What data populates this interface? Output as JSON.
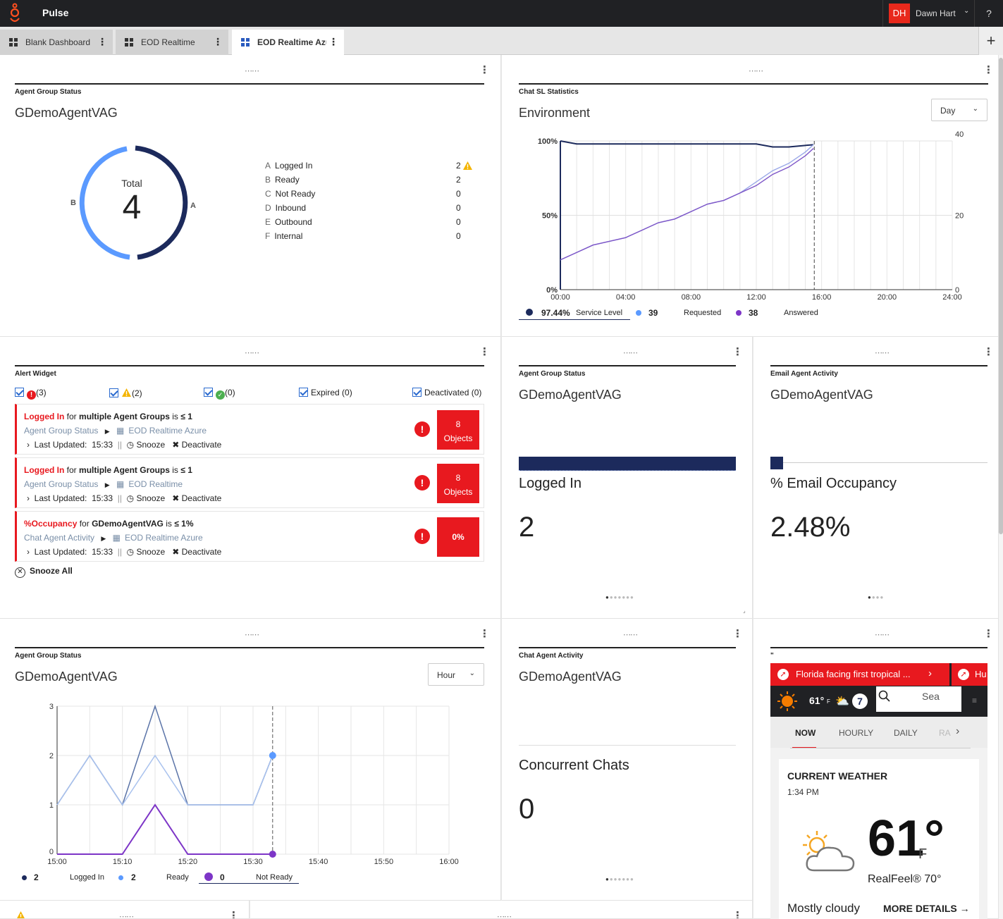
{
  "app": {
    "title": "Pulse",
    "user_initials": "DH",
    "user_name": "Dawn Hart",
    "help": "?"
  },
  "tabs": [
    {
      "label": "Blank Dashboard"
    },
    {
      "label": "EOD Realtime"
    },
    {
      "label": "EOD Realtime Azure"
    }
  ],
  "agent_status": {
    "type": "Agent Group Status",
    "title": "GDemoAgentVAG",
    "total_label": "Total",
    "total": "4",
    "seg_a": "A",
    "seg_b": "B",
    "legend": [
      {
        "letter": "A",
        "label": "Logged In",
        "value": "2"
      },
      {
        "letter": "B",
        "label": "Ready",
        "value": "2"
      },
      {
        "letter": "C",
        "label": "Not Ready",
        "value": "0"
      },
      {
        "letter": "D",
        "label": "Inbound",
        "value": "0"
      },
      {
        "letter": "E",
        "label": "Outbound",
        "value": "0"
      },
      {
        "letter": "F",
        "label": "Internal",
        "value": "0"
      }
    ]
  },
  "chat_sl": {
    "type": "Chat SL Statistics",
    "title": "Environment",
    "period": "Day",
    "legend": {
      "sl_value": "97.44%",
      "sl_label": "Service Level",
      "req_value": "39",
      "req_label": "Requested",
      "ans_value": "38",
      "ans_label": "Answered"
    }
  },
  "alerts": {
    "type": "Alert Widget",
    "filters": {
      "red": "(3)",
      "warn": "(2)",
      "ok": "(0)",
      "expired": "Expired (0)",
      "deactivated": "Deactivated (0)"
    },
    "items": [
      {
        "metric": "Logged In",
        "for": "for",
        "object": "multiple Agent Groups",
        "is": "is",
        "cond": "≤ 1",
        "src": "Agent Group Status",
        "dash": "EOD Realtime Azure",
        "updated_label": "Last Updated:",
        "time": "15:33",
        "snooze": "Snooze",
        "deactivate": "Deactivate",
        "count_n": "8",
        "count_l": "Objects"
      },
      {
        "metric": "Logged In",
        "for": "for",
        "object": "multiple Agent Groups",
        "is": "is",
        "cond": "≤ 1",
        "src": "Agent Group Status",
        "dash": "EOD Realtime",
        "updated_label": "Last Updated:",
        "time": "15:33",
        "snooze": "Snooze",
        "deactivate": "Deactivate",
        "count_n": "8",
        "count_l": "Objects"
      },
      {
        "metric": "%Occupancy",
        "for": "for",
        "object": "GDemoAgentVAG",
        "is": "is",
        "cond": "≤ 1%",
        "src": "Chat Agent Activity",
        "dash": "EOD Realtime Azure",
        "updated_label": "Last Updated:",
        "time": "15:33",
        "snooze": "Snooze",
        "deactivate": "Deactivate",
        "count_n": "0%",
        "count_l": ""
      }
    ],
    "snooze_all": "Snooze All"
  },
  "kpi_logged": {
    "type": "Agent Group Status",
    "title": "GDemoAgentVAG",
    "label": "Logged In",
    "value": "2"
  },
  "kpi_email": {
    "type": "Email Agent Activity",
    "title": "GDemoAgentVAG",
    "label": "% Email Occupancy",
    "value": "2.48%",
    "fill": 0.0248
  },
  "agent_hour": {
    "type": "Agent Group Status",
    "title": "GDemoAgentVAG",
    "period": "Hour",
    "legend": {
      "li_value": "2",
      "li_label": "Logged In",
      "rd_value": "2",
      "rd_label": "Ready",
      "nr_value": "0",
      "nr_label": "Not Ready"
    }
  },
  "kpi_chat": {
    "type": "Chat Agent Activity",
    "title": "GDemoAgentVAG",
    "label": "Concurrent Chats",
    "value": "0"
  },
  "weather": {
    "type": "\"",
    "news1": "Florida facing first tropical ...",
    "news2": "Hu",
    "temp_small": "61°",
    "unit_small": "F",
    "search": "Sea",
    "nav": [
      "NOW",
      "HOURLY",
      "DAILY",
      "RA"
    ],
    "card_title": "CURRENT WEATHER",
    "time": "1:34 PM",
    "temp": "61°",
    "unit": "F",
    "realfeel": "RealFeel® 70°",
    "cond": "Mostly cloudy",
    "more": "MORE DETAILS"
  },
  "chart_data": [
    {
      "type": "line",
      "title": "Environment",
      "x": [
        "00:00",
        "01:00",
        "02:00",
        "03:00",
        "04:00",
        "05:00",
        "06:00",
        "07:00",
        "08:00",
        "09:00",
        "10:00",
        "11:00",
        "12:00",
        "13:00",
        "14:00",
        "15:00",
        "15:30"
      ],
      "x_ticks": [
        "00:00",
        "04:00",
        "08:00",
        "12:00",
        "16:00",
        "20:00",
        "24:00"
      ],
      "y_ticks_left": [
        "0%",
        "50%",
        "100%"
      ],
      "y_ticks_right": [
        "0",
        "20",
        "40"
      ],
      "xlim": [
        0,
        24
      ],
      "ylim_left": [
        0,
        100
      ],
      "ylim_right": [
        0,
        40
      ],
      "series": [
        {
          "name": "Service Level",
          "axis": "left",
          "color": "#1c2a5c",
          "values": [
            100,
            98,
            98,
            98,
            98,
            98,
            98,
            98,
            98,
            98,
            98,
            98,
            98,
            96,
            96,
            97,
            97.44
          ]
        },
        {
          "name": "Requested",
          "axis": "right",
          "color": "#9aa8e8",
          "values": [
            8,
            10,
            12,
            13,
            14,
            16,
            18,
            19,
            21,
            23,
            24,
            26,
            29,
            32,
            34,
            37,
            39
          ]
        },
        {
          "name": "Answered",
          "axis": "right",
          "color": "#7d55c7",
          "values": [
            8,
            10,
            12,
            13,
            14,
            16,
            18,
            19,
            21,
            23,
            24,
            26,
            28,
            31,
            33,
            36,
            38
          ]
        }
      ],
      "grid": true
    },
    {
      "type": "line",
      "title": "GDemoAgentVAG",
      "x": [
        "15:00",
        "15:05",
        "15:10",
        "15:15",
        "15:20",
        "15:25",
        "15:30",
        "15:33"
      ],
      "x_ticks": [
        "15:00",
        "15:10",
        "15:20",
        "15:30",
        "15:40",
        "15:50",
        "16:00"
      ],
      "y_ticks": [
        "0",
        "1",
        "2",
        "3"
      ],
      "ylim": [
        0,
        3
      ],
      "series": [
        {
          "name": "Logged In",
          "color": "#5b74a8",
          "values": [
            1,
            2,
            1,
            3,
            1,
            1,
            1,
            2
          ]
        },
        {
          "name": "Ready",
          "color": "#a9c2ee",
          "values": [
            1,
            2,
            1,
            2,
            1,
            1,
            1,
            2
          ]
        },
        {
          "name": "Not Ready",
          "color": "#7d35c7",
          "values": [
            0,
            0,
            0,
            1,
            0,
            0,
            0,
            0
          ]
        }
      ],
      "grid": true
    }
  ]
}
